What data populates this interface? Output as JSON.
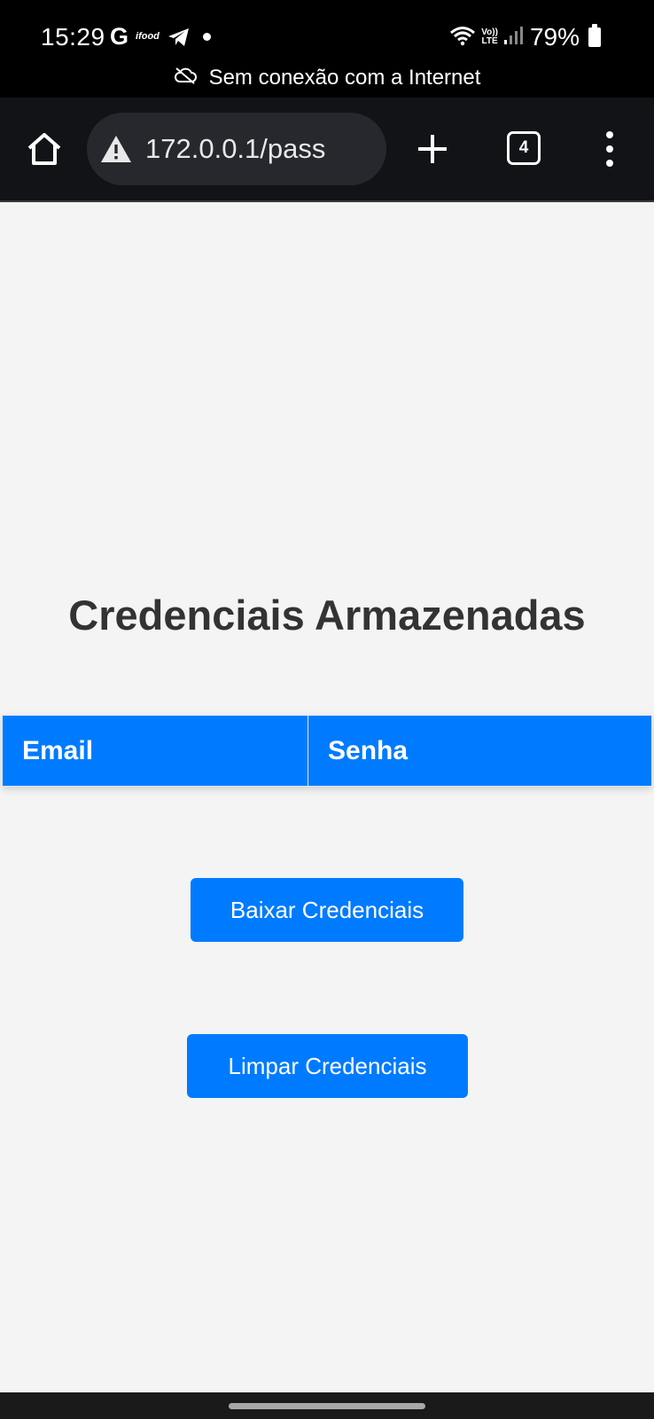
{
  "status_bar": {
    "time": "15:29",
    "notification_icons": [
      "google-icon",
      "ifood-icon",
      "telegram-icon",
      "dot-icon"
    ],
    "g_label": "G",
    "ifood_label": "ifood",
    "lte_label_top": "Vo))",
    "lte_label_bottom": "LTE",
    "battery": "79%",
    "offline_message": "Sem conexão com a Internet"
  },
  "browser": {
    "url": "172.0.0.1/pass",
    "tab_count": "4"
  },
  "page": {
    "title": "Credenciais Armazenadas",
    "table": {
      "headers": [
        "Email",
        "Senha"
      ]
    },
    "buttons": {
      "download": "Baixar Credenciais",
      "clear": "Limpar Credenciais"
    }
  },
  "colors": {
    "accent": "#007bff",
    "page_background": "#f4f4f4",
    "toolbar_background": "#121317",
    "title_text": "#333333"
  }
}
